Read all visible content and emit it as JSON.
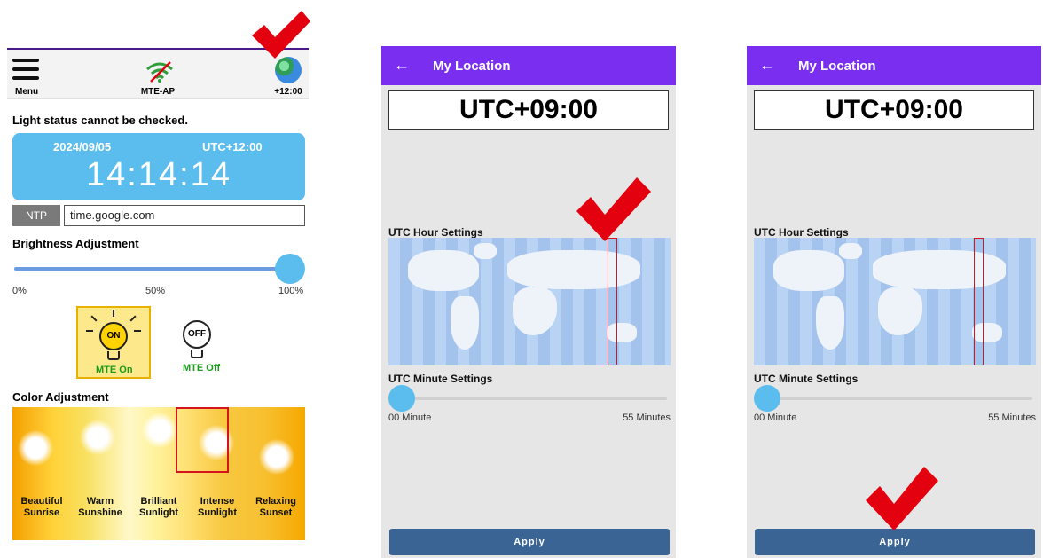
{
  "panel1": {
    "menu_label": "Menu",
    "wifi_label": "MTE-AP",
    "tz_label": "+12:00",
    "light_status": "Light status cannot be checked.",
    "clock": {
      "date": "2024/09/05",
      "utc": "UTC+12:00",
      "time": "14:14:14"
    },
    "ntp": {
      "button": "NTP",
      "server": "time.google.com"
    },
    "brightness": {
      "title": "Brightness Adjustment",
      "min": "0%",
      "mid": "50%",
      "max": "100%",
      "value_percent": 100
    },
    "mte_on": {
      "bulb_text": "ON",
      "label": "MTE On"
    },
    "mte_off": {
      "bulb_text": "OFF",
      "label": "MTE Off"
    },
    "color": {
      "title": "Color Adjustment",
      "options": [
        {
          "line1": "Beautiful",
          "line2": "Sunrise"
        },
        {
          "line1": "Warm",
          "line2": "Sunshine"
        },
        {
          "line1": "Brilliant",
          "line2": "Sunlight"
        },
        {
          "line1": "Intense",
          "line2": "Sunlight"
        },
        {
          "line1": "Relaxing",
          "line2": "Sunset"
        }
      ],
      "selected": "Intense Sunlight"
    }
  },
  "location_screens": [
    {
      "title": "My Location",
      "utc_display": "UTC+09:00",
      "hour_title": "UTC Hour Settings",
      "minute_title": "UTC Minute Settings",
      "minute_min": "00 Minute",
      "minute_max": "55 Minutes",
      "apply": "Apply"
    },
    {
      "title": "My Location",
      "utc_display": "UTC+09:00",
      "hour_title": "UTC Hour Settings",
      "minute_title": "UTC Minute Settings",
      "minute_min": "00 Minute",
      "minute_max": "55 Minutes",
      "apply": "Apply"
    }
  ],
  "colors": {
    "header_purple": "#7a2ff0",
    "clock_blue": "#5bbcee",
    "apply_blue": "#3a6494",
    "check_red": "#e3000f",
    "mte_green": "#1a9b1a"
  },
  "icons": [
    "menu-icon",
    "wifi-off-icon",
    "globe-icon",
    "bulb-on-icon",
    "bulb-off-icon",
    "back-arrow-icon",
    "check-mark-icon"
  ]
}
